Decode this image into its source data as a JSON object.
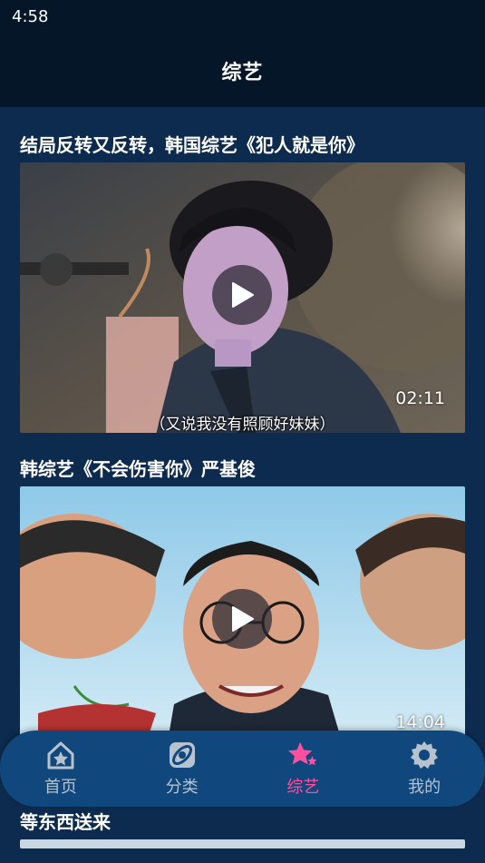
{
  "status_bar": {
    "time": "4:58"
  },
  "header": {
    "title": "综艺"
  },
  "feed": {
    "items": [
      {
        "title": "结局反转又反转，韩国综艺《犯人就是你》",
        "duration": "02:11",
        "subtitle": "（又说我没有照顾好妹妹）"
      },
      {
        "title": "韩综艺《不会伤害你》严基俊",
        "duration": "14:04"
      },
      {
        "title": "等东西送来"
      }
    ]
  },
  "tab_bar": {
    "tabs": [
      {
        "label": "首页",
        "icon": "home-icon",
        "active": false
      },
      {
        "label": "分类",
        "icon": "category-icon",
        "active": false
      },
      {
        "label": "综艺",
        "icon": "star-icon",
        "active": true
      },
      {
        "label": "我的",
        "icon": "settings-icon",
        "active": false
      }
    ]
  },
  "colors": {
    "background": "#0d2b4e",
    "header": "#041628",
    "tab_bar": "#10477c",
    "active_tab": "#ff4fa0",
    "inactive_tab": "#b7c2cf"
  }
}
